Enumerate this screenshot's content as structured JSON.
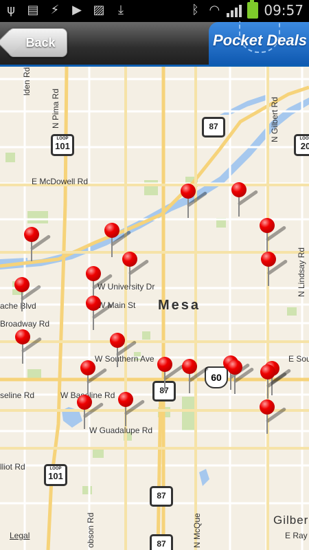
{
  "status_bar": {
    "time": "09:57",
    "left_icons": [
      "usb-icon",
      "sd-card-icon",
      "sync-icon",
      "play-store-icon",
      "image-icon",
      "download-icon"
    ],
    "right_icons": [
      "bluetooth-icon",
      "wifi-icon",
      "signal-icon",
      "battery-icon"
    ]
  },
  "header": {
    "back_label": "Back",
    "brand_label": "Pocket Deals",
    "accent_color": "#0f59b1"
  },
  "map": {
    "city": "Mesa",
    "legal_link": "Legal",
    "roads": {
      "pima": "N Pima Rd",
      "gilbert_n": "N Gilbert Rd",
      "lindsay": "N Lindsay Rd",
      "mcdowell": "E McDowell Rd",
      "university": "W University Dr",
      "main": "W Main St",
      "apache": "ache Blvd",
      "broadway": "Broadway Rd",
      "southern": "W Southern Ave",
      "e_southern": "E Sou",
      "baseline_w": "seline Rd",
      "baseline": "W Baseline Rd",
      "guadalupe": "W Guadalupe Rd",
      "elliot": "lliot Rd",
      "ray": "E Ray R",
      "dobson": "obson Rd",
      "mcqueen": "N McQue",
      "alma": "lden Rd",
      "gilbert_city": "Gilber",
      "rd_edge": "Rd"
    },
    "shields": {
      "loop101_top": "101",
      "loop101_bottom": "101",
      "loop_label": "LOOP",
      "sr87_top": "87",
      "sr87_mid": "87",
      "sr87_low": "87",
      "sr87_bottom": "87",
      "us60": "60",
      "route202": "20"
    },
    "pin_color": "#e00000",
    "pin_count": 24
  }
}
